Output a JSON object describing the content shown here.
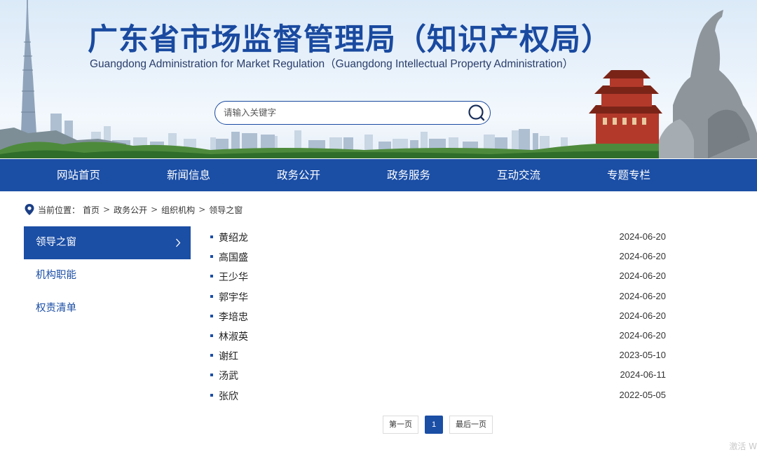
{
  "header": {
    "title_cn": "广东省市场监督管理局（知识产权局）",
    "title_en": "Guangdong Administration for Market Regulation（Guangdong Intellectual Property Administration）",
    "search_placeholder": "请输入关键字"
  },
  "nav": {
    "items": [
      "网站首页",
      "新闻信息",
      "政务公开",
      "政务服务",
      "互动交流",
      "专题专栏"
    ]
  },
  "breadcrumb": {
    "label": "当前位置：",
    "items": [
      "首页",
      "政务公开",
      "组织机构",
      "领导之窗"
    ],
    "separator": ">"
  },
  "sidebar": {
    "items": [
      "领导之窗",
      "机构职能",
      "权责清单"
    ],
    "active_index": 0
  },
  "list": {
    "rows": [
      {
        "name": "黄绍龙",
        "date": "2024-06-20"
      },
      {
        "name": "高国盛",
        "date": "2024-06-20"
      },
      {
        "name": "王少华",
        "date": "2024-06-20"
      },
      {
        "name": "郭宇华",
        "date": "2024-06-20"
      },
      {
        "name": "李培忠",
        "date": "2024-06-20"
      },
      {
        "name": "林淑英",
        "date": "2024-06-20"
      },
      {
        "name": "谢红",
        "date": "2023-05-10"
      },
      {
        "name": "汤武",
        "date": "2024-06-11"
      },
      {
        "name": "张欣",
        "date": "2022-05-05"
      }
    ]
  },
  "pagination": {
    "first": "第一页",
    "current": "1",
    "last": "最后一页"
  },
  "watermark": "激活 W",
  "colors": {
    "brand_blue": "#1b4ea5",
    "title_blue": "#1a4aa0"
  },
  "icons": {
    "search": "search-icon",
    "location": "location-pin-icon",
    "chevron": "chevron-right-icon"
  }
}
